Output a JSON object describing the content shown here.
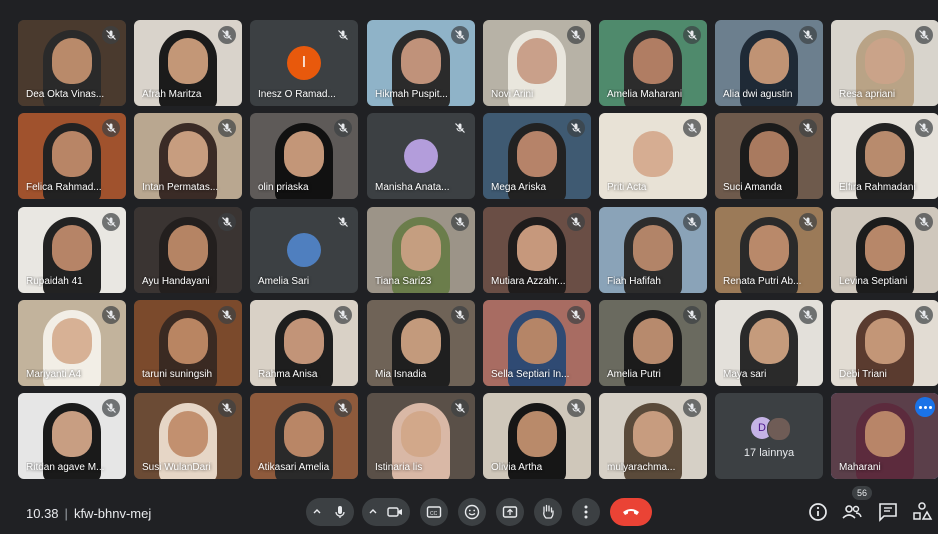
{
  "participants": [
    {
      "name": "Dea Okta Vinas...",
      "bg": "#4a3a2e",
      "skin": "#b98a6a",
      "hijab": "#2a2a2a"
    },
    {
      "name": "Afrah Maritza",
      "bg": "#d9d3cb",
      "skin": "#c39777",
      "hijab": "#1b1b1b"
    },
    {
      "name": "Inesz O Ramad...",
      "avatar_letter": "I",
      "avatar_color": "#e8590c"
    },
    {
      "name": "Hikmah Puspit...",
      "bg": "#8fb3c8",
      "skin": "#c0927a",
      "hijab": "#2b2b2b"
    },
    {
      "name": "Novi Arini",
      "bg": "#b7b2a6",
      "skin": "#c9a08a",
      "hijab": "#e9e6dd"
    },
    {
      "name": "Amelia Maharani",
      "bg": "#4f8a6c",
      "skin": "#b07d63",
      "hijab": "#2c2c2c"
    },
    {
      "name": "Alia dwi agustin",
      "bg": "#6c7f8e",
      "skin": "#c09374",
      "hijab": "#1f2a36"
    },
    {
      "name": "Resa apriani",
      "bg": "#d8d4cc",
      "skin": "#caa389",
      "hijab": "#b9a386"
    },
    {
      "name": "Felica Rahmad...",
      "bg": "#a0522d",
      "skin": "#b88566",
      "hijab": "#222"
    },
    {
      "name": "Intan Permatas...",
      "bg": "#b9a790",
      "skin": "#c79d7f",
      "hijab": "#3a2b26"
    },
    {
      "name": "olin priaska",
      "bg": "#5e5a58",
      "skin": "#c39678",
      "hijab": "#111"
    },
    {
      "name": "Manisha Anata...",
      "avatar_img": "purple-cartoon-avatar",
      "avatar_color": "#b39ddb"
    },
    {
      "name": "Mega Ariska",
      "bg": "#3f5a72",
      "skin": "#b68369",
      "hijab": "#222"
    },
    {
      "name": "Priti Acta",
      "bg": "#e8e2d6",
      "skin": "#d6ad92",
      "hijab": "#e8e2d6"
    },
    {
      "name": "Suci Amanda",
      "bg": "#6e5a4c",
      "skin": "#a97a5f",
      "hijab": "#1b1b1b"
    },
    {
      "name": "Elfira Rahmadani",
      "bg": "#e5e1da",
      "skin": "#b88b6d",
      "hijab": "#222"
    },
    {
      "name": "Rupaidah 41",
      "bg": "#e9e7e2",
      "skin": "#b68467",
      "hijab": "#222"
    },
    {
      "name": "Ayu Handayani",
      "bg": "#3a3432",
      "skin": "#b58464",
      "hijab": "#231f1e"
    },
    {
      "name": "Amelia Sari",
      "avatar_img": "landscape-avatar",
      "avatar_color": "#4f7fbf"
    },
    {
      "name": "Tiana Sari23",
      "bg": "#9c9488",
      "skin": "#c59e80",
      "hijab": "#6b7d4b"
    },
    {
      "name": "Mutiara Azzahr...",
      "bg": "#6a4e45",
      "skin": "#c6987c",
      "hijab": "#1f1c1c"
    },
    {
      "name": "Fiah Hafifah",
      "bg": "#8aa3b8",
      "skin": "#b28468",
      "hijab": "#2c2c2c"
    },
    {
      "name": "Renata Putri Ab...",
      "bg": "#9b7a58",
      "skin": "#b9896a",
      "hijab": "#2a2a2a"
    },
    {
      "name": "Levina Septiani",
      "bg": "#cfc7bc",
      "skin": "#b78769",
      "hijab": "#1c1c1c"
    },
    {
      "name": "Mariyanti A4",
      "bg": "#c2b39c",
      "skin": "#d7b195",
      "hijab": "#f2eee6"
    },
    {
      "name": "taruni suningsih",
      "bg": "#7b4a2c",
      "skin": "#b98562",
      "hijab": "#3a2a22"
    },
    {
      "name": "Rahma Anisa",
      "bg": "#d9d1c6",
      "skin": "#c29478",
      "hijab": "#1e1e1e"
    },
    {
      "name": "Mia Isnadia",
      "bg": "#6f6357",
      "skin": "#c39a7c",
      "hijab": "#1f1f1f"
    },
    {
      "name": "Sella Septiari In...",
      "bg": "#a86c62",
      "skin": "#b58567",
      "hijab": "#2f4a73"
    },
    {
      "name": "Amelia Putri",
      "bg": "#6a6a5f",
      "skin": "#b78a6d",
      "hijab": "#1b1b1b"
    },
    {
      "name": "Maya sari",
      "bg": "#e3e0da",
      "skin": "#c59b7c",
      "hijab": "#2a2a2a"
    },
    {
      "name": "Debi Triani",
      "bg": "#e2dcd3",
      "skin": "#c39677",
      "hijab": "#5a3b2f"
    },
    {
      "name": "Ritdan agave M...",
      "bg": "#e6e6e6",
      "skin": "#c89e82",
      "hijab": "#1a1a1a"
    },
    {
      "name": "Susi WulanDari",
      "bg": "#6b4b35",
      "skin": "#c2906f",
      "hijab": "#e6d6c6"
    },
    {
      "name": "Atikasari Amelia",
      "bg": "#8e5a3c",
      "skin": "#b98666",
      "hijab": "#2a2a2a"
    },
    {
      "name": "Istinaria lis",
      "bg": "#5a5048",
      "skin": "#d2a88a",
      "hijab": "#d9b8a6"
    },
    {
      "name": "Olivia Artha",
      "bg": "#cfc7ba",
      "skin": "#b98a6a",
      "hijab": "#161616"
    },
    {
      "name": "mulyarachma...",
      "bg": "#d6d0c6",
      "skin": "#c79c7f",
      "hijab": "#5a4a3a"
    },
    {
      "more_tile": true,
      "label": "17 lainnya",
      "letter": "D"
    },
    {
      "name": "Maharani",
      "bg": "#5b3f4a",
      "skin": "#b88568",
      "hijab": "#5c2b3d",
      "selected": true
    }
  ],
  "bottom": {
    "time": "10.38",
    "meeting_code": "kfw-bhnv-mej",
    "participants_badge": "56"
  },
  "colors": {
    "end_call": "#ea4335",
    "accent": "#8ab4f8",
    "control_bg": "#3c4043"
  }
}
